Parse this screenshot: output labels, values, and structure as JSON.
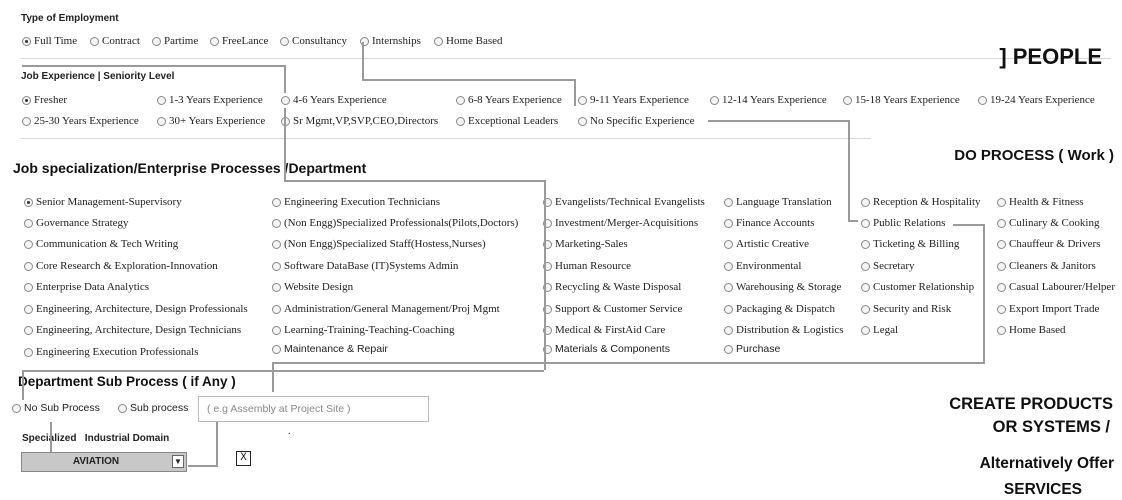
{
  "employment": {
    "title": "Type of Employment",
    "options": [
      "Full Time",
      "Contract",
      "Partime",
      "FreeLance",
      "Consultancy",
      "Internships",
      "Home Based"
    ],
    "selected": 0
  },
  "experience": {
    "title": "Job Experience | Seniority Level",
    "options": [
      "Fresher",
      "1-3 Years Experience",
      "4-6 Years Experience",
      "6-8 Years Experience",
      "9-11 Years Experience",
      "12-14 Years Experience",
      "15-18 Years Experience",
      "19-24 Years Experience",
      "25-30 Years Experience",
      "30+ Years Experience",
      "Sr Mgmt,VP,SVP,CEO,Directors",
      "Exceptional Leaders",
      "No Specific Experience"
    ],
    "selected": 0
  },
  "specialization": {
    "title": "Job specialization/Enterprise Processes /Department",
    "columns": [
      [
        "Senior Management-Supervisory",
        "Governance Strategy",
        "Communication & Tech Writing",
        "Core Research & Exploration-Innovation",
        "Enterprise Data Analytics",
        "Engineering, Architecture, Design Professionals",
        "Engineering, Architecture, Design Technicians",
        "Engineering Execution Professionals"
      ],
      [
        "Engineering Execution Technicians",
        "(Non Engg)Specialized Professionals(Pilots,Doctors)",
        "(Non Engg)Specialized Staff(Hostess,Nurses)",
        "Software DataBase (IT)Systems Admin",
        "Website Design",
        "Administration/General Management/Proj Mgmt",
        "Learning-Training-Teaching-Coaching",
        "Maintenance & Repair"
      ],
      [
        "Evangelists/Technical Evangelists",
        "Investment/Merger-Acquisitions",
        "Marketing-Sales",
        "Human Resource",
        "Recycling & Waste Disposal",
        "Support & Customer Service",
        "Medical & FirstAid Care",
        "Materials  & Components"
      ],
      [
        "Language Translation",
        "Finance Accounts",
        "Artistic Creative",
        "Environmental",
        "Warehousing & Storage",
        "Packaging & Dispatch",
        "Distribution & Logistics",
        "Purchase"
      ],
      [
        "Reception & Hospitality",
        "Public Relations",
        "Ticketing & Billing",
        "Secretary",
        "Customer Relationship",
        "Security and Risk",
        "Legal"
      ],
      [
        "Health & Fitness",
        "Culinary & Cooking",
        "Chauffeur & Drivers",
        "Cleaners & Janitors",
        "Casual Labourer/Helper",
        "Export Import Trade",
        "Home Based"
      ]
    ],
    "selected": "Senior Management-Supervisory"
  },
  "subprocess": {
    "title": "Department Sub Process ( if Any )",
    "no_label": "No Sub Process",
    "yes_label": "Sub process",
    "placeholder": "( e.g Assembly at Project Site )",
    "dot": "."
  },
  "domain": {
    "title": "Specialized   Industrial Domain",
    "value": "AVIATION",
    "close_label": "X"
  },
  "right": {
    "people": "] PEOPLE",
    "process": "DO PROCESS ( Work )",
    "create_line1": "CREATE PRODUCTS",
    "create_line2": "OR SYSTEMS /",
    "alt_line1": "Alternatively Offer",
    "alt_line2": "SERVICES"
  }
}
